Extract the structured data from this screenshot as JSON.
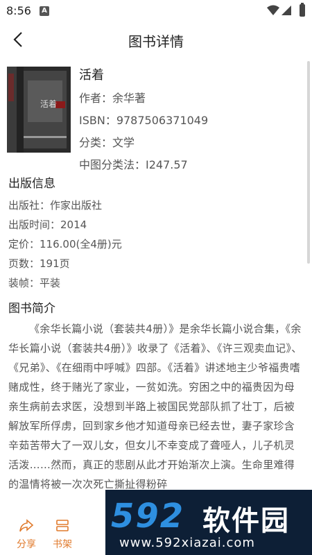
{
  "status": {
    "time": "8:56",
    "notif_icon": "A"
  },
  "nav": {
    "title": "图书详情"
  },
  "book": {
    "title": "活着",
    "author": "作者：余华著",
    "isbn": "ISBN：9787506371049",
    "category": "分类：文学",
    "clc": "中图分类法：I247.57",
    "cover_text": "活着"
  },
  "publish": {
    "heading": "出版信息",
    "publisher": "出版社：作家出版社",
    "date": "出版时间：2014",
    "price": "定价：116.00(全4册)元",
    "pages": "页数：191页",
    "binding": "装帧：平装"
  },
  "intro": {
    "heading": "图书简介",
    "text": "《余华长篇小说（套装共4册）》是余华长篇小说合集，《余华长篇小说（套装共4册）》收录了《活着》、《许三观卖血记》、《兄弟》、《在细雨中呼喊》四部。《活着》讲述地主少爷福贵嗜赌成性，终于赌光了家业，一贫如洗。穷困之中的福贵因为母亲生病前去求医，没想到半路上被国民党部队抓了壮丁，后被解放军所俘虏，回到家乡他才知道母亲已经去世，妻子家珍含辛茹苦带大了一双儿女，但女儿不幸变成了聋哑人，儿子机灵活泼……然而，真正的悲剧从此才开始渐次上演。生命里难得的温情将被一次次死亡撕扯得粉碎"
  },
  "actions": {
    "share": "分享",
    "shelf": "书架"
  },
  "watermark": {
    "brand_num": "592",
    "brand_cn": "软件园",
    "url": "www.592xiazai.com"
  },
  "colors": {
    "accent": "#e07a2c",
    "watermark_blue": "#2e8fe0"
  }
}
